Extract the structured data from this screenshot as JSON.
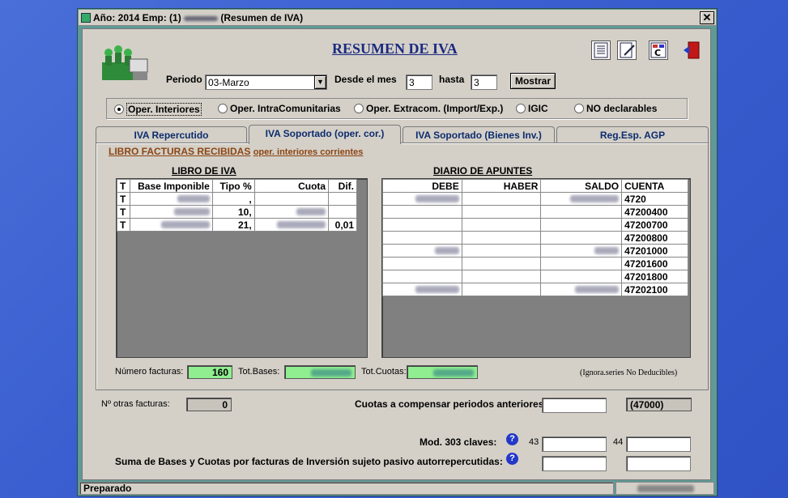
{
  "window": {
    "title": "Año: 2014 Emp: (1)",
    "title_suffix": "(Resumen de IVA)",
    "close": "✕"
  },
  "header": {
    "heading": "RESUMEN DE IVA",
    "periodo_label": "Periodo",
    "periodo_value": "03-Marzo",
    "desde_label": "Desde el mes",
    "desde_value": "3",
    "hasta_label": "hasta",
    "hasta_value": "3",
    "mostrar": "Mostrar"
  },
  "tools": [
    {
      "icon": "list-report-icon"
    },
    {
      "icon": "edit-document-icon"
    },
    {
      "icon": "calculator-c-icon"
    },
    {
      "icon": "exit-door-icon"
    }
  ],
  "radios": [
    {
      "label": "Oper. Interiores",
      "selected": true
    },
    {
      "label": "Oper. IntraComunitarias",
      "selected": false
    },
    {
      "label": "Oper. Extracom. (Import/Exp.)",
      "selected": false
    },
    {
      "label": "IGIC",
      "selected": false
    },
    {
      "label": "NO declarables",
      "selected": false
    }
  ],
  "tabs": [
    "IVA Repercutido",
    "IVA Soportado (oper. cor.)",
    "IVA Soportado (Bienes Inv.)",
    "Reg.Esp. AGP"
  ],
  "section": {
    "title": "LIBRO FACTURAS RECIBIDAS",
    "subtitle": "oper. interiores corrientes"
  },
  "libro": {
    "title": "LIBRO DE IVA",
    "columns": [
      "T",
      "Base Imponible",
      "Tipo %",
      "Cuota",
      "Dif."
    ],
    "rows": [
      {
        "t": "T",
        "tipo": ",",
        "dif": ""
      },
      {
        "t": "T",
        "tipo": "10,",
        "dif": ""
      },
      {
        "t": "T",
        "tipo": "21,",
        "dif": "0,01"
      }
    ]
  },
  "diario": {
    "title": "DIARIO DE APUNTES",
    "columns": [
      "DEBE",
      "HABER",
      "SALDO",
      "CUENTA"
    ],
    "rows": [
      {
        "cuenta": "4720",
        "debe": true
      },
      {
        "cuenta": "47200400",
        "debe": false
      },
      {
        "cuenta": "47200700",
        "debe": false
      },
      {
        "cuenta": "47200800",
        "debe": false
      },
      {
        "cuenta": "47201000",
        "debe": true
      },
      {
        "cuenta": "47201600",
        "debe": false
      },
      {
        "cuenta": "47201800",
        "debe": false
      },
      {
        "cuenta": "47202100",
        "debe": true
      }
    ]
  },
  "totals": {
    "num_facturas_label": "Número facturas:",
    "num_facturas": "160",
    "tot_bases_label": "Tot.Bases:",
    "tot_cuotas_label": "Tot.Cuotas:",
    "ignora": "(Ignora.series No Deducibles)"
  },
  "bottom": {
    "otras_label": "Nº otras facturas:",
    "otras_value": "0",
    "cuotas_label": "Cuotas a compensar periodos anteriores",
    "cuenta_ref": "(47000)",
    "mod303_label": "Mod. 303 claves:",
    "clave1": "43",
    "clave2": "44",
    "suma_label": "Suma de Bases y Cuotas por facturas de Inversión sujeto pasivo autorrepercutidas:"
  },
  "status": {
    "text": "Preparado"
  }
}
